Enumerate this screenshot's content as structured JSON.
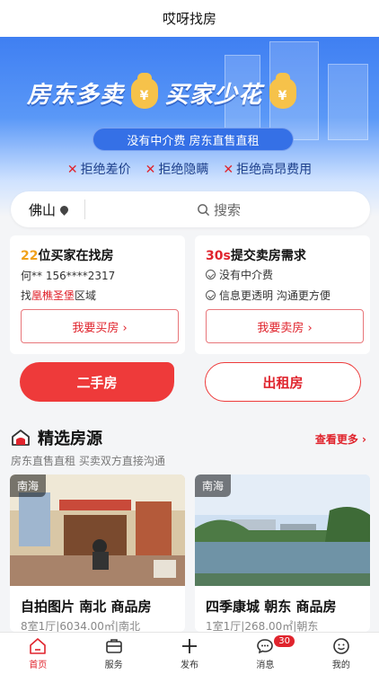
{
  "app": {
    "title": "哎呀找房"
  },
  "banner": {
    "headline_left": "房东多卖",
    "headline_right": "买家少花",
    "bag_symbol": "¥",
    "pill": "没有中介费  房东直售直租",
    "rejects": [
      "拒绝差价",
      "拒绝隐瞒",
      "拒绝高昂费用"
    ],
    "reject_mark": "✕"
  },
  "search": {
    "city": "佛山",
    "placeholder": "搜索"
  },
  "buyer_card": {
    "count": "22",
    "title_suffix": "位买家在找房",
    "person": "何** 156****2317",
    "seek_prefix": "找",
    "seek_area": "凰樵圣堡",
    "seek_suffix": "区域",
    "button": "我要买房 ›"
  },
  "seller_card": {
    "count": "30s",
    "title_suffix": "提交卖房需求",
    "points": [
      "没有中介费",
      "信息更透明  沟通更方便"
    ],
    "button": "我要卖房 ›"
  },
  "big_buttons": {
    "second_hand": "二手房",
    "rental": "出租房"
  },
  "section": {
    "title": "精选房源",
    "more": "查看更多",
    "subtitle": "房东直售直租  买卖双方直接沟通"
  },
  "listings": [
    {
      "district": "南海",
      "title": "自拍图片 南北 商品房",
      "info": "8室1厅|6034.00㎡|南北"
    },
    {
      "district": "南海",
      "title": "四季康城 朝东 商品房",
      "info": "1室1厅|268.00㎡|朝东"
    }
  ],
  "tabbar": {
    "items": [
      {
        "label": "首页",
        "icon": "home-icon"
      },
      {
        "label": "服务",
        "icon": "service-icon"
      },
      {
        "label": "发布",
        "icon": "plus-icon"
      },
      {
        "label": "消息",
        "icon": "chat-icon"
      },
      {
        "label": "我的",
        "icon": "profile-icon"
      }
    ],
    "message_badge": "30"
  },
  "colors": {
    "accent": "#e0242d",
    "banner_blue": "#3f7ff2",
    "count_orange": "#f0a11a"
  }
}
